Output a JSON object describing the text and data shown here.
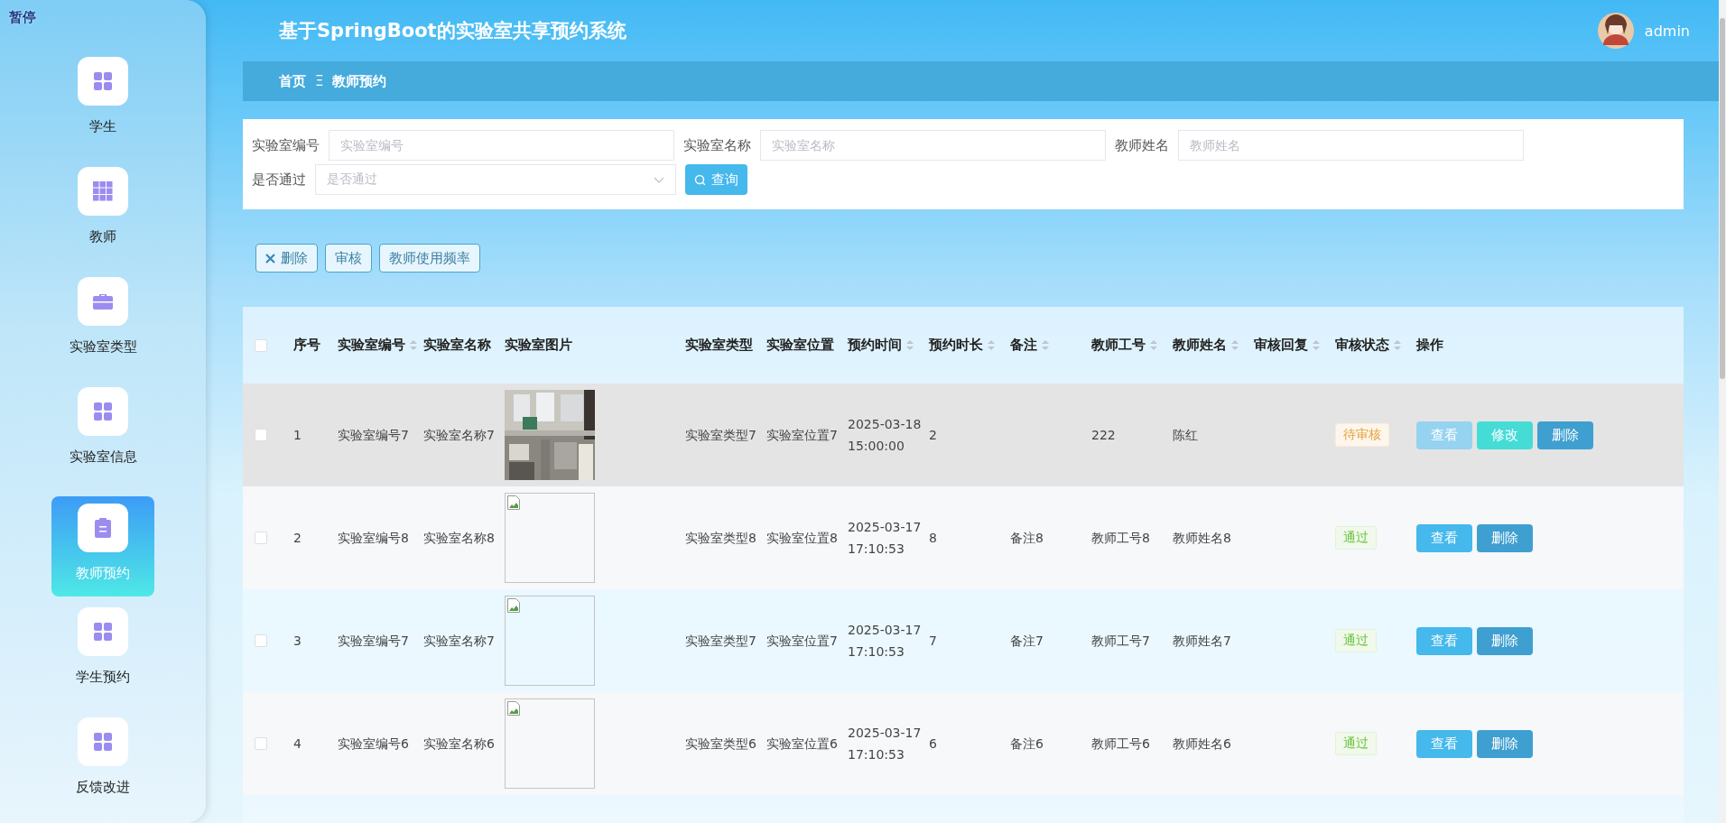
{
  "pause_label": "暂停",
  "sidebar": {
    "items": [
      {
        "label": "学生",
        "selected": false
      },
      {
        "label": "教师",
        "selected": false
      },
      {
        "label": "实验室类型",
        "selected": false
      },
      {
        "label": "实验室信息",
        "selected": false
      },
      {
        "label": "教师预约",
        "selected": true
      },
      {
        "label": "学生预约",
        "selected": false
      },
      {
        "label": "反馈改进",
        "selected": false
      }
    ]
  },
  "header": {
    "title": "基于SpringBoot的实验室共享预约系统",
    "user": "admin"
  },
  "breadcrumb": {
    "home": "首页",
    "separator": "Ξ",
    "current": "教师预约"
  },
  "filters": {
    "fields": [
      {
        "label": "实验室编号",
        "placeholder": "实验室编号",
        "kind": "text"
      },
      {
        "label": "实验室名称",
        "placeholder": "实验室名称",
        "kind": "text"
      },
      {
        "label": "教师姓名",
        "placeholder": "教师姓名",
        "kind": "text"
      },
      {
        "label": "是否通过",
        "placeholder": "是否通过",
        "kind": "select"
      }
    ],
    "search_button": "查询"
  },
  "toolbar": [
    {
      "label": "删除",
      "kind": "delete"
    },
    {
      "label": "审核",
      "kind": "plain"
    },
    {
      "label": "教师使用频率",
      "kind": "plain"
    }
  ],
  "table": {
    "select_all": {
      "checked": false
    },
    "columns": [
      {
        "label": "序号",
        "sortable": false
      },
      {
        "label": "实验室编号",
        "sortable": true
      },
      {
        "label": "实验室名称",
        "sortable": false
      },
      {
        "label": "实验室图片",
        "sortable": false
      },
      {
        "label": "实验室类型",
        "sortable": false
      },
      {
        "label": "实验室位置",
        "sortable": false
      },
      {
        "label": "预约时间",
        "sortable": true
      },
      {
        "label": "预约时长",
        "sortable": true
      },
      {
        "label": "备注",
        "sortable": true
      },
      {
        "label": "教师工号",
        "sortable": true
      },
      {
        "label": "教师姓名",
        "sortable": true
      },
      {
        "label": "审核回复",
        "sortable": true
      },
      {
        "label": "审核状态",
        "sortable": true
      },
      {
        "label": "操作",
        "sortable": false
      }
    ],
    "rows": [
      {
        "hovered": true,
        "checked": false,
        "cells": [
          "1",
          "实验室编号7",
          "实验室名称7",
          "",
          "实验室类型7",
          "实验室位置7",
          "2025-03-18 15:00:00",
          "2",
          "",
          "222",
          "陈红",
          ""
        ],
        "image": {
          "kind": "picture"
        },
        "status": {
          "label": "待审核",
          "kind": "pending"
        },
        "actions": [
          {
            "label": "查看",
            "kind": "view",
            "hovered": true
          },
          {
            "label": "修改",
            "kind": "edit",
            "hovered": false
          },
          {
            "label": "删除",
            "kind": "delete",
            "hovered": false
          }
        ]
      },
      {
        "hovered": false,
        "checked": false,
        "cells": [
          "2",
          "实验室编号8",
          "实验室名称8",
          "",
          "实验室类型8",
          "实验室位置8",
          "2025-03-17 17:10:53",
          "8",
          "备注8",
          "教师工号8",
          "教师姓名8",
          ""
        ],
        "status": {
          "label": "通过",
          "kind": "approved"
        },
        "actions": [
          {
            "label": "查看",
            "kind": "view",
            "hovered": false
          },
          {
            "label": "删除",
            "kind": "delete",
            "hovered": false
          }
        ]
      },
      {
        "hovered": false,
        "checked": false,
        "cells": [
          "3",
          "实验室编号7",
          "实验室名称7",
          "",
          "实验室类型7",
          "实验室位置7",
          "2025-03-17 17:10:53",
          "7",
          "备注7",
          "教师工号7",
          "教师姓名7",
          ""
        ],
        "status": {
          "label": "通过",
          "kind": "approved"
        },
        "actions": [
          {
            "label": "查看",
            "kind": "view",
            "hovered": false
          },
          {
            "label": "删除",
            "kind": "delete",
            "hovered": false
          }
        ]
      },
      {
        "hovered": false,
        "checked": false,
        "cells": [
          "4",
          "实验室编号6",
          "实验室名称6",
          "",
          "实验室类型6",
          "实验室位置6",
          "2025-03-17 17:10:53",
          "6",
          "备注6",
          "教师工号6",
          "教师姓名6",
          ""
        ],
        "status": {
          "label": "通过",
          "kind": "approved"
        },
        "actions": [
          {
            "label": "查看",
            "kind": "view",
            "hovered": false
          },
          {
            "label": "删除",
            "kind": "delete",
            "hovered": false
          }
        ]
      }
    ]
  }
}
